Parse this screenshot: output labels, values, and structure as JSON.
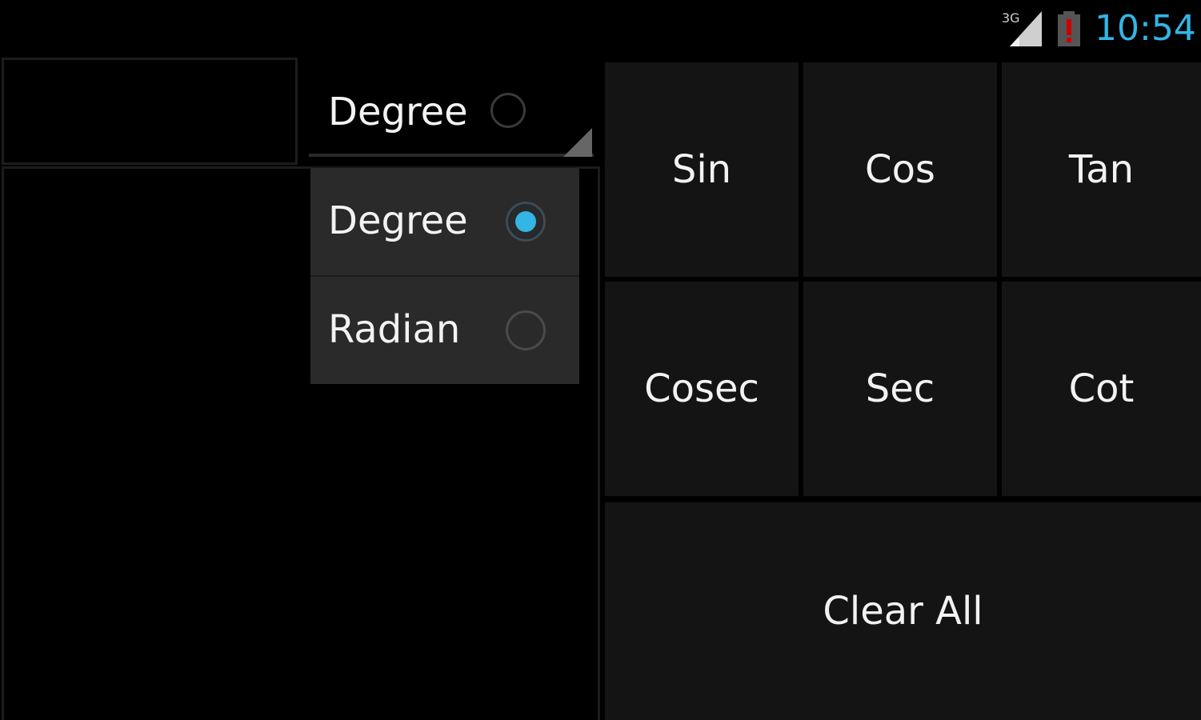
{
  "status_bar": {
    "network": "3G",
    "time": "10:54",
    "accent_color": "#33b5e5",
    "battery_alert_color": "#cc0000",
    "icons": [
      "signal-3g-icon",
      "battery-alert-icon"
    ]
  },
  "unit_spinner": {
    "selected": "Degree"
  },
  "unit_dropdown": {
    "options": [
      {
        "label": "Degree",
        "checked": true
      },
      {
        "label": "Radian",
        "checked": false
      }
    ]
  },
  "functions": {
    "sin": "Sin",
    "cos": "Cos",
    "tan": "Tan",
    "cosec": "Cosec",
    "sec": "Sec",
    "cot": "Cot",
    "clear_all": "Clear All"
  },
  "colors": {
    "background": "#000000",
    "button_bg": "#141414",
    "dropdown_bg": "#2a2a2a",
    "radio_selected": "#33b5e5"
  }
}
